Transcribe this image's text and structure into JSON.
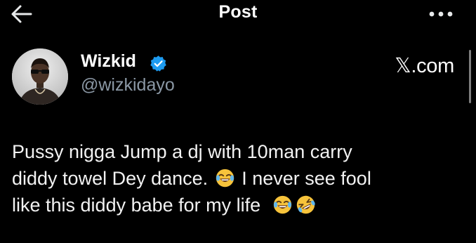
{
  "header": {
    "title": "Post",
    "back_icon": "arrow-left-icon",
    "more_icon": "more-horizontal-icon"
  },
  "author": {
    "name": "Wizkid",
    "handle": "@wizkidayo",
    "verified": true,
    "verified_color": "#1d9bf0"
  },
  "site": "𝕏.com",
  "tweet": {
    "line1": "Pussy nigga Jump a dj with 10man carry",
    "line2a": "diddy towel Dey dance.",
    "line2b": "I never see fool",
    "line3": "like this diddy babe for my life",
    "emojis": [
      "face-with-tears-of-joy-emoji",
      "face-with-tears-of-joy-emoji",
      "rolling-on-floor-laughing-emoji"
    ]
  },
  "colors": {
    "background": "#000000",
    "text": "#e7e9ea",
    "secondary_text": "#8b98a5",
    "accent": "#1d9bf0"
  }
}
